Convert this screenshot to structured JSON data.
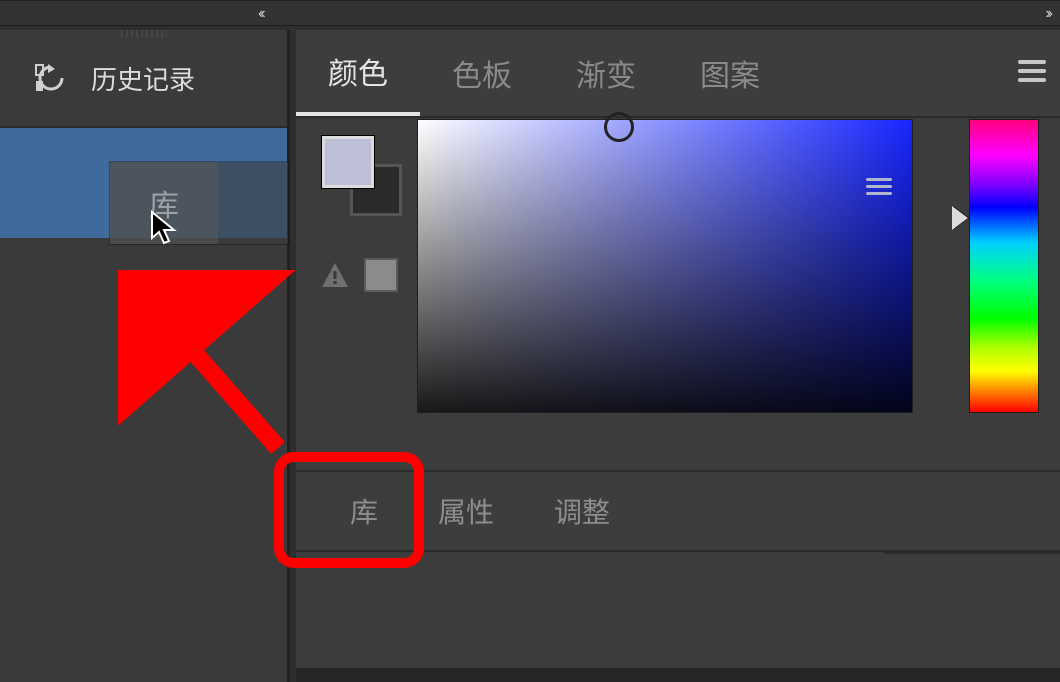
{
  "sidebar": {
    "title": "历史记录"
  },
  "dragged_tab": {
    "label": "库"
  },
  "tabs": [
    {
      "label": "颜色",
      "active": true
    },
    {
      "label": "色板",
      "active": false
    },
    {
      "label": "渐变",
      "active": false
    },
    {
      "label": "图案",
      "active": false
    }
  ],
  "tabs2": [
    {
      "label": "库"
    },
    {
      "label": "属性"
    },
    {
      "label": "调整"
    }
  ],
  "colors": {
    "foreground": "#bcbfd6",
    "background": "#2a2a2a",
    "field_hue": "#1726ff"
  }
}
